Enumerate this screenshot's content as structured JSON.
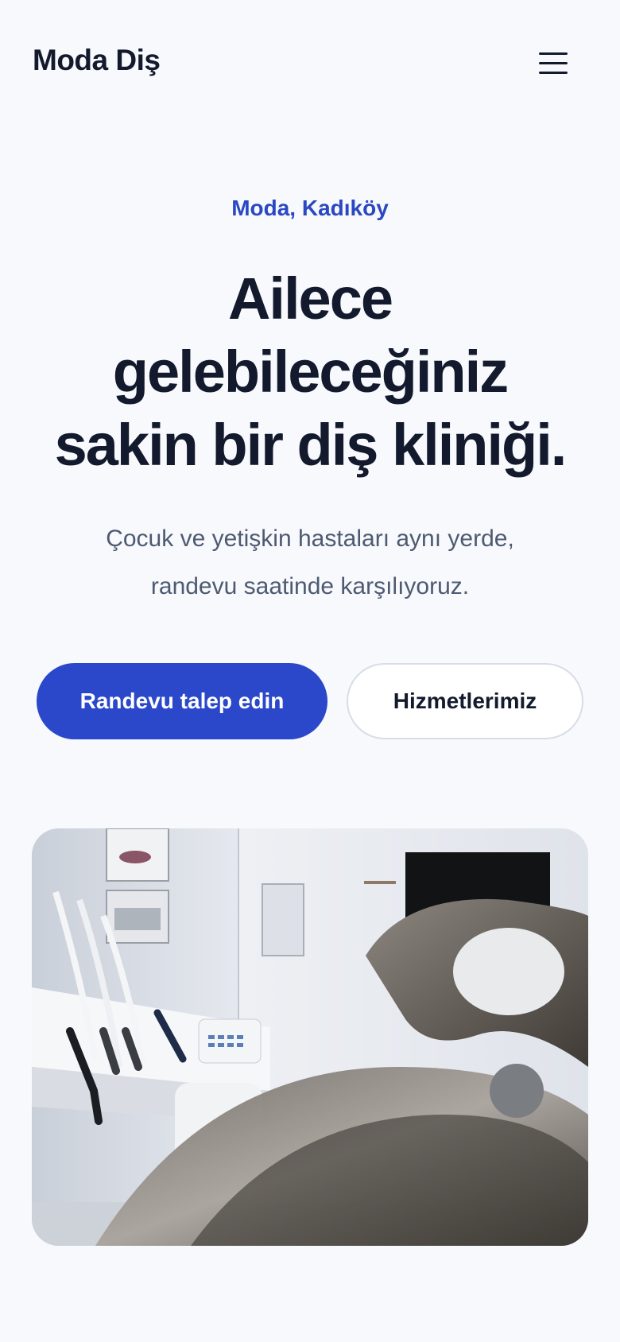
{
  "header": {
    "brand": "Moda Diş",
    "menu_icon": "hamburger-menu-icon"
  },
  "hero": {
    "eyebrow": "Moda, Kadıköy",
    "headline_line1": "Ailece",
    "headline_line2": "gelebileceğiniz",
    "headline_line3": "sakin bir diş kliniği.",
    "subtitle_line1": "Çocuk ve yetişkin hastaları aynı yerde,",
    "subtitle_line2": "randevu saatinde karşılıyoruz.",
    "primary_button": "Randevu talep edin",
    "secondary_button": "Hizmetlerimiz"
  },
  "colors": {
    "accent": "#2a48c9",
    "text_dark": "#131a2d",
    "text_muted": "#4e5a72",
    "background": "#f7f9fc"
  }
}
